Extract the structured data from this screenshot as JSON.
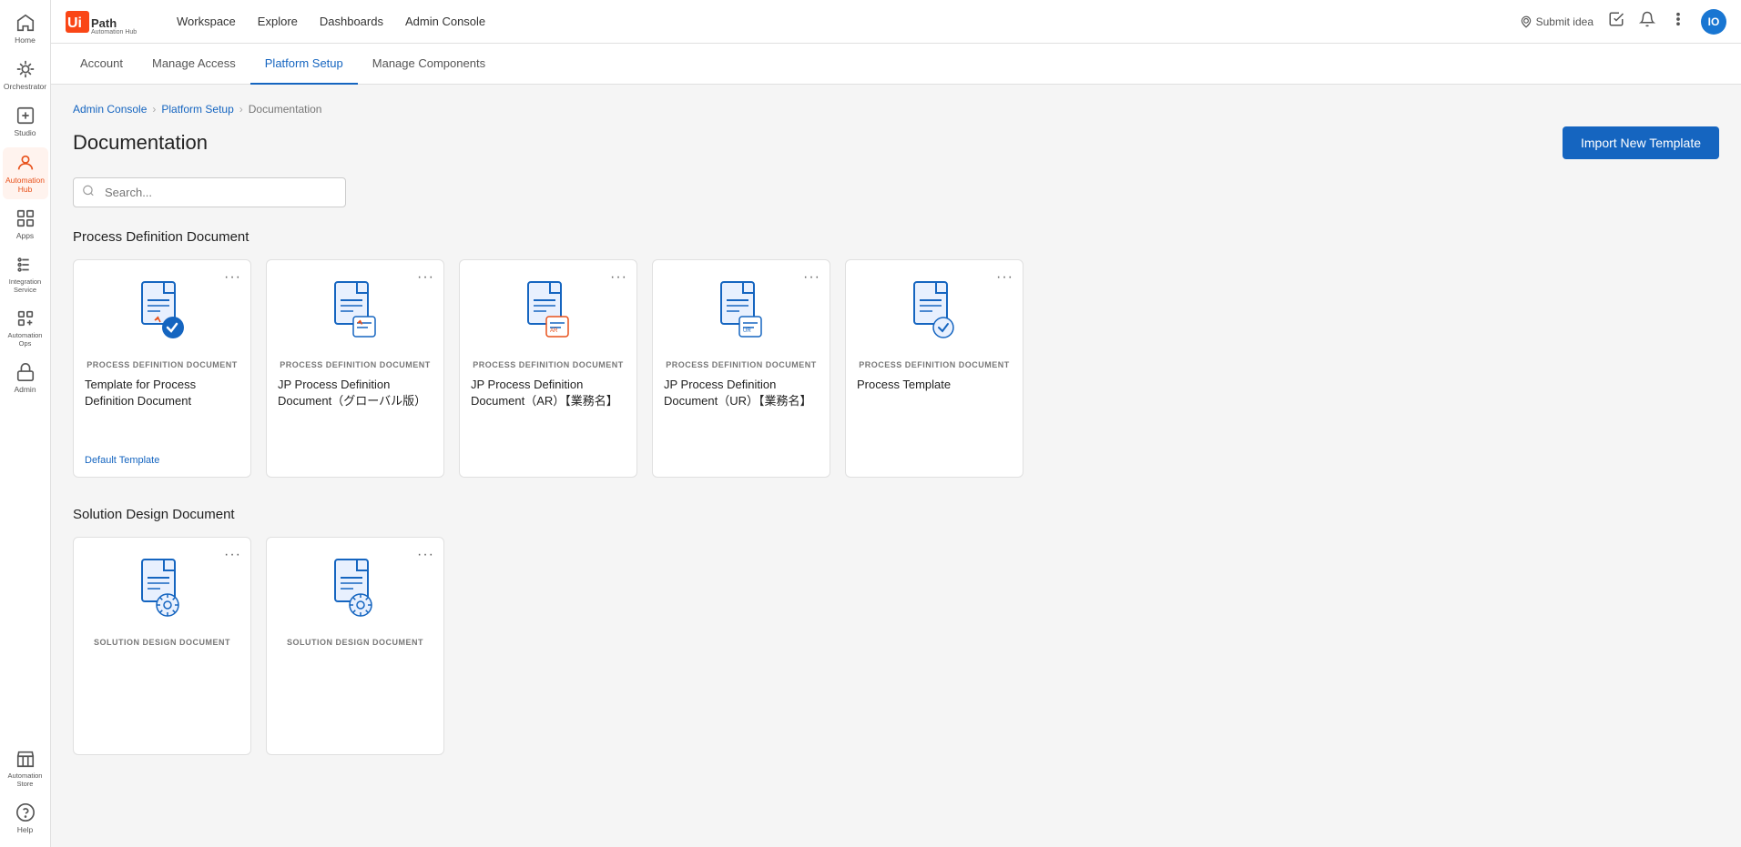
{
  "topnav": {
    "logo": "UiPath Automation Hub",
    "links": [
      "Workspace",
      "Explore",
      "Dashboards",
      "Admin Console"
    ],
    "submit_idea": "Submit idea",
    "avatar_initials": "IO"
  },
  "tabs": [
    {
      "label": "Account",
      "active": false
    },
    {
      "label": "Manage Access",
      "active": false
    },
    {
      "label": "Platform Setup",
      "active": true
    },
    {
      "label": "Manage Components",
      "active": false
    }
  ],
  "breadcrumb": {
    "items": [
      "Admin Console",
      "Platform Setup",
      "Documentation"
    ]
  },
  "page": {
    "title": "Documentation",
    "import_button": "Import New Template"
  },
  "search": {
    "placeholder": "Search..."
  },
  "sections": [
    {
      "title": "Process Definition Document",
      "cards": [
        {
          "type": "PROCESS DEFINITION DOCUMENT",
          "name": "Template for Process Definition Document",
          "badge": "Default Template",
          "icon_color": "#1565c0"
        },
        {
          "type": "PROCESS DEFINITION DOCUMENT",
          "name": "JP Process Definition Document（グローバル版）",
          "badge": "",
          "icon_color": "#1565c0"
        },
        {
          "type": "PROCESS DEFINITION DOCUMENT",
          "name": "JP Process Definition Document（AR）【業務名】",
          "badge": "",
          "icon_color": "#1565c0"
        },
        {
          "type": "PROCESS DEFINITION DOCUMENT",
          "name": "JP Process Definition Document（UR）【業務名】",
          "badge": "",
          "icon_color": "#1565c0"
        },
        {
          "type": "PROCESS DEFINITION DOCUMENT",
          "name": "Process Template",
          "badge": "",
          "icon_color": "#1565c0"
        }
      ]
    },
    {
      "title": "Solution Design Document",
      "cards": [
        {
          "type": "SOLUTION DESIGN DOCUMENT",
          "name": "",
          "badge": "",
          "icon_color": "#1565c0"
        },
        {
          "type": "SOLUTION DESIGN DOCUMENT",
          "name": "",
          "badge": "",
          "icon_color": "#1565c0"
        }
      ]
    }
  ],
  "sidebar": {
    "items": [
      {
        "label": "Home",
        "icon": "home",
        "active": false
      },
      {
        "label": "Orchestrator",
        "icon": "orchestrator",
        "active": false
      },
      {
        "label": "Studio",
        "icon": "studio",
        "active": false
      },
      {
        "label": "Automation Hub",
        "icon": "automation-hub",
        "active": true
      },
      {
        "label": "Apps",
        "icon": "apps",
        "active": false
      },
      {
        "label": "Integration Service",
        "icon": "integration",
        "active": false
      },
      {
        "label": "Automation Ops",
        "icon": "automation-ops",
        "active": false
      },
      {
        "label": "Admin",
        "icon": "admin",
        "active": false
      },
      {
        "label": "Automation Store",
        "icon": "store",
        "active": false
      },
      {
        "label": "Help",
        "icon": "help",
        "active": false
      }
    ]
  }
}
